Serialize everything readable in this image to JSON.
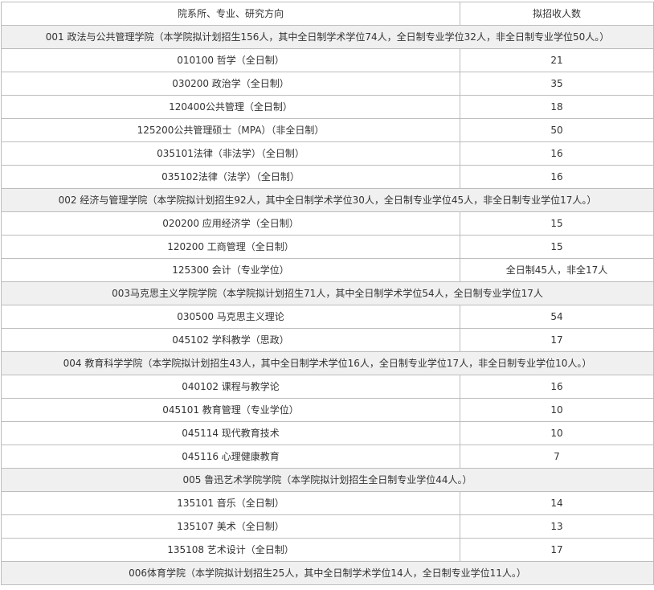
{
  "header": {
    "col_major": "院系所、专业、研究方向",
    "col_quota": "拟招收人数"
  },
  "rows": [
    {
      "type": "dept",
      "text": "001 政法与公共管理学院（本学院拟计划招生156人，其中全日制学术学位74人，全日制专业学位32人，非全日制专业学位50人。）"
    },
    {
      "type": "major",
      "name": "010100 哲学（全日制）",
      "quota": "21"
    },
    {
      "type": "major",
      "name": "030200 政治学（全日制）",
      "quota": "35"
    },
    {
      "type": "major",
      "name": "120400公共管理（全日制）",
      "quota": "18"
    },
    {
      "type": "major",
      "name": "125200公共管理硕士（MPA）（非全日制）",
      "quota": "50"
    },
    {
      "type": "major",
      "name": "035101法律（非法学）（全日制）",
      "quota": "16"
    },
    {
      "type": "major",
      "name": "035102法律（法学）（全日制）",
      "quota": "16"
    },
    {
      "type": "dept",
      "text": "002 经济与管理学院（本学院拟计划招生92人，其中全日制学术学位30人，全日制专业学位45人，非全日制专业学位17人。）"
    },
    {
      "type": "major",
      "name": "020200 应用经济学（全日制）",
      "quota": "15"
    },
    {
      "type": "major",
      "name": "120200 工商管理（全日制）",
      "quota": "15"
    },
    {
      "type": "major",
      "name": "125300 会计（专业学位）",
      "quota": "全日制45人，非全17人"
    },
    {
      "type": "dept",
      "text": "003马克思主义学院学院（本学院拟计划招生71人，其中全日制学术学位54人，全日制专业学位17人"
    },
    {
      "type": "major",
      "name": "030500 马克思主义理论",
      "quota": "54"
    },
    {
      "type": "major",
      "name": "045102 学科教学（思政）",
      "quota": "17"
    },
    {
      "type": "dept",
      "text": "004 教育科学学院（本学院拟计划招生43人，其中全日制学术学位16人，全日制专业学位17人，非全日制专业学位10人。）"
    },
    {
      "type": "major",
      "name": "040102 课程与教学论",
      "quota": "16"
    },
    {
      "type": "major",
      "name": "045101 教育管理（专业学位）",
      "quota": "10"
    },
    {
      "type": "major",
      "name": "045114 现代教育技术",
      "quota": "10"
    },
    {
      "type": "major",
      "name": "045116 心理健康教育",
      "quota": "7"
    },
    {
      "type": "dept",
      "text": "005 鲁迅艺术学院学院（本学院拟计划招生全日制专业学位44人。）"
    },
    {
      "type": "major",
      "name": "135101 音乐（全日制）",
      "quota": "14"
    },
    {
      "type": "major",
      "name": "135107 美术（全日制）",
      "quota": "13"
    },
    {
      "type": "major",
      "name": "135108 艺术设计（全日制）",
      "quota": "17"
    },
    {
      "type": "dept",
      "text": "006体育学院（本学院拟计划招生25人，其中全日制学术学位14人，全日制专业学位11人。）"
    }
  ]
}
